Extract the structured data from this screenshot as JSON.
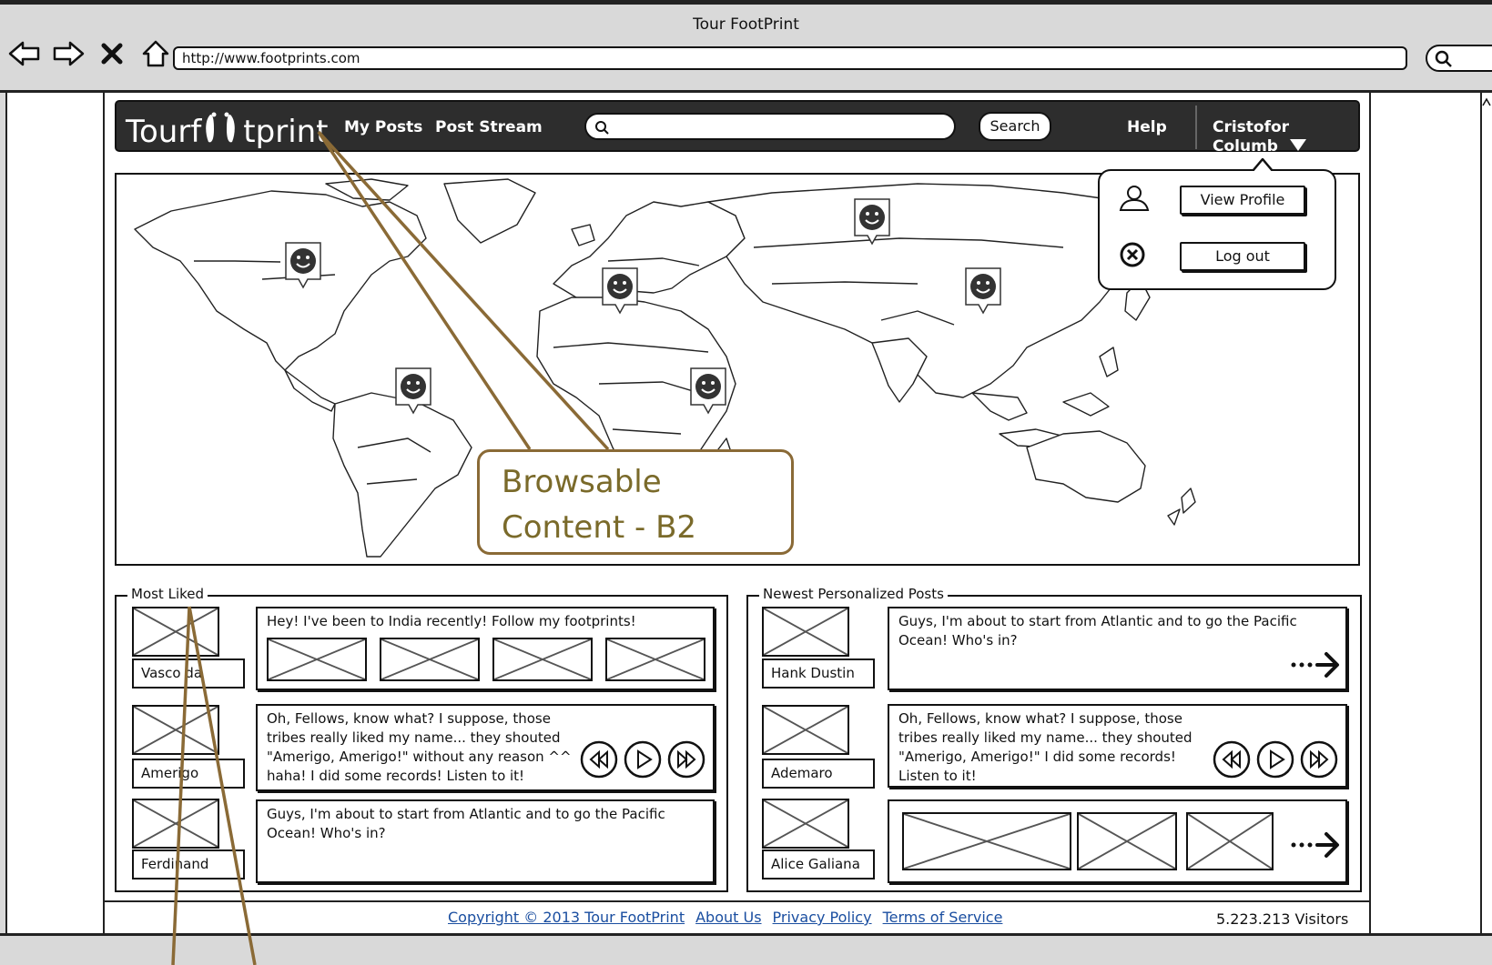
{
  "window": {
    "title": "Tour FootPrint"
  },
  "browser": {
    "url": "http://www.footprints.com"
  },
  "app": {
    "logo_text": "Tourf tprint",
    "nav": {
      "my_posts": "My Posts",
      "post_stream": "Post Stream",
      "search_button": "Search",
      "help": "Help",
      "user_name": "Cristofor Columb"
    },
    "search": {
      "value": ""
    }
  },
  "user_menu": {
    "view_profile": "View Profile",
    "log_out": "Log out"
  },
  "annotation": {
    "line1": "Browsable",
    "line2": "Content - B2"
  },
  "most_liked": {
    "title": "Most Liked",
    "rows": [
      {
        "name": "Vasco da",
        "text": "Hey! I've been to India recently! Follow my footprints!"
      },
      {
        "name": "Amerigo",
        "text": "Oh, Fellows, know what? I suppose, those tribes really liked my name... they shouted \"Amerigo, Amerigo!\" without any reason ^^ haha! I did some records! Listen to it!"
      },
      {
        "name": "Ferdinand",
        "text": "Guys, I'm about to start from Atlantic and to go the Pacific Ocean! Who's in?"
      }
    ]
  },
  "newest": {
    "title": "Newest Personalized Posts",
    "rows": [
      {
        "name": "Hank Dustin",
        "text": "Guys, I'm about to start from Atlantic and to go the Pacific Ocean! Who's in?"
      },
      {
        "name": "Ademaro",
        "text": "Oh, Fellows, know what? I suppose, those tribes really liked my name... they shouted \"Amerigo, Amerigo!\" I did some records! Listen to it!"
      },
      {
        "name": "Alice Galiana",
        "text": ""
      }
    ]
  },
  "footer": {
    "copyright": "Copyright © 2013 Tour FootPrint",
    "about": "About Us",
    "privacy": "Privacy Policy",
    "terms": "Terms of Service",
    "visitors": "5.223.213 Visitors"
  },
  "icons": {
    "back": "arrow-left-icon",
    "forward": "arrow-right-icon",
    "stop": "close-icon",
    "home": "home-icon",
    "search": "search-icon",
    "user": "user-icon",
    "logout": "circle-x-icon",
    "dropdown": "triangle-down-icon",
    "pin": "smiley-pin-icon",
    "rewind": "rewind-icon",
    "play": "play-icon",
    "forward_media": "fast-forward-icon",
    "more": "dotted-arrow-icon"
  }
}
